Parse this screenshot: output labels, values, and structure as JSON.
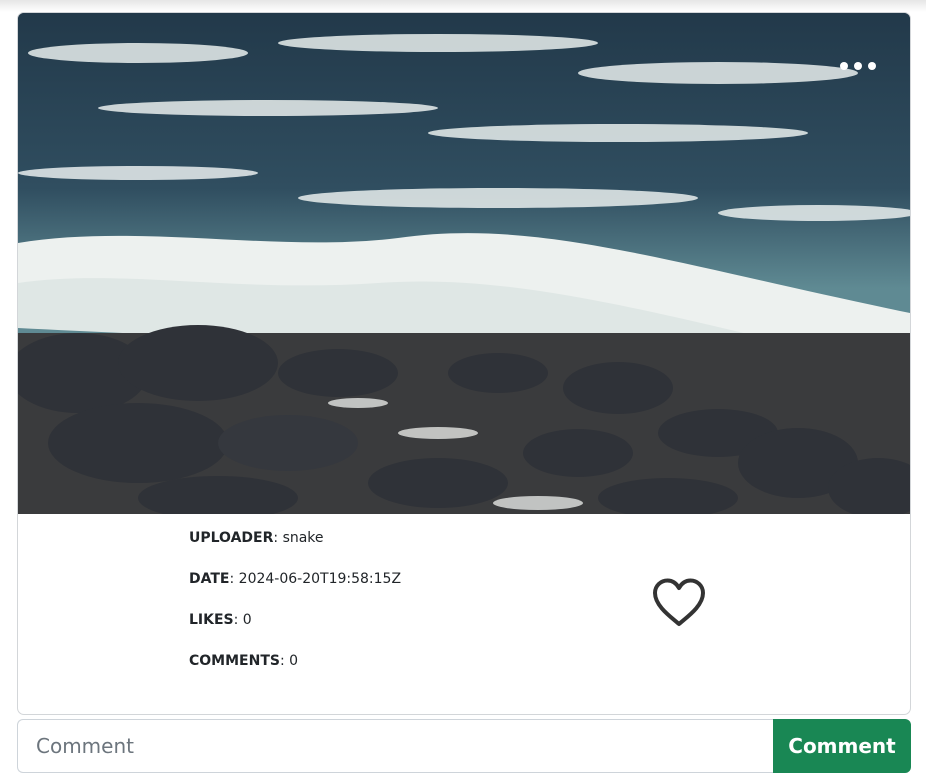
{
  "post": {
    "more_icon": "ellipsis-icon",
    "uploader_label": "UPLOADER",
    "uploader_value": "snake",
    "date_label": "DATE",
    "date_value": "2024-06-20T19:58:15Z",
    "likes_label": "LIKES",
    "likes_value": "0",
    "comments_label": "COMMENTS",
    "comments_value": "0",
    "like_icon": "heart-outline-icon"
  },
  "comment": {
    "placeholder": "Comment",
    "button_label": "Comment"
  },
  "colors": {
    "button": "#198754",
    "border": "#d3d6d9"
  }
}
